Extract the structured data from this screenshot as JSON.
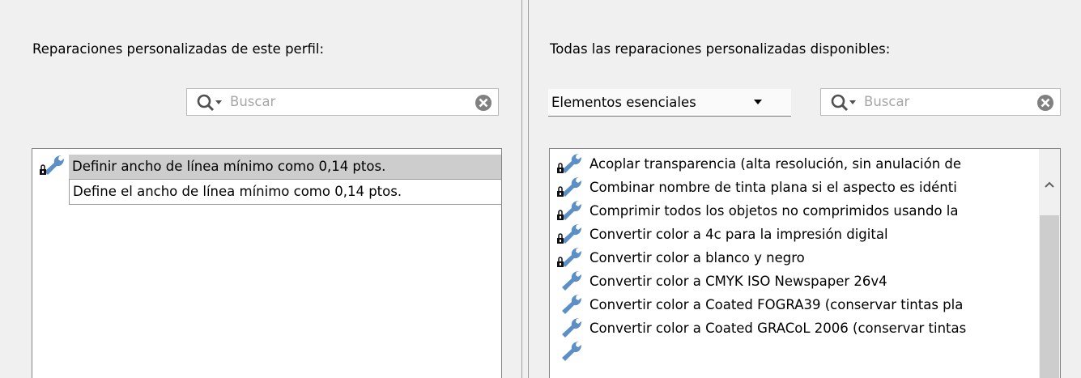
{
  "left_panel": {
    "heading": "Reparaciones personalizadas de este perfil:",
    "search_placeholder": "Buscar",
    "items": [
      {
        "label": "Definir ancho de línea mínimo como 0,14 ptos.",
        "locked": true,
        "selected": true
      }
    ],
    "description": "Define el ancho de línea mínimo como 0,14 ptos."
  },
  "right_panel": {
    "heading": "Todas las reparaciones personalizadas disponibles:",
    "category_selected": "Elementos esenciales",
    "search_placeholder": "Buscar",
    "items": [
      {
        "label": "Acoplar transparencia (alta resolución, sin anulación de",
        "locked": true
      },
      {
        "label": "Combinar nombre de tinta plana si el aspecto es idénti",
        "locked": true
      },
      {
        "label": "Comprimir todos los objetos no comprimidos usando la",
        "locked": true
      },
      {
        "label": "Convertir color a 4c para la impresión digital",
        "locked": true
      },
      {
        "label": "Convertir color a blanco y negro",
        "locked": true
      },
      {
        "label": "Convertir color a CMYK ISO Newspaper 26v4",
        "locked": false
      },
      {
        "label": "Convertir color a Coated FOGRA39 (conservar tintas pla",
        "locked": false
      },
      {
        "label": "Convertir color a Coated GRACoL 2006 (conservar tintas",
        "locked": false
      }
    ]
  },
  "icons": {
    "search": "magnifier-dropdown-icon",
    "clear": "clear-circle-icon",
    "fixup": "wrench-icon",
    "lock": "lock-icon",
    "scroll_up": "chevron-up-icon"
  },
  "colors": {
    "wrench": "#5b8fc6",
    "selection": "#cdcdcd",
    "placeholder": "#a6a6a6"
  }
}
